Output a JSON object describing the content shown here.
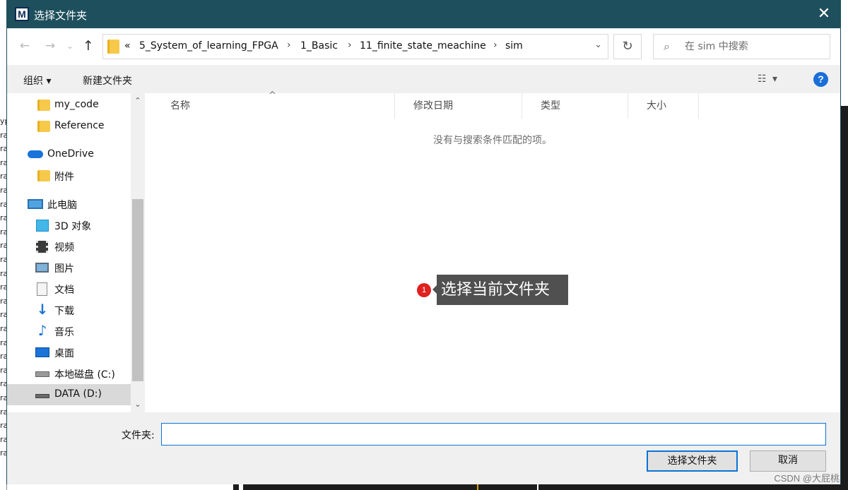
{
  "window": {
    "title": "选择文件夹",
    "app_icon_letter": "M",
    "close_glyph": "✕"
  },
  "nav": {
    "back_glyph": "←",
    "forward_glyph": "→",
    "history_glyph": "⌄",
    "up_glyph": "↑",
    "overflow_glyph": "«",
    "breadcrumbs": [
      "5_System_of_learning_FPGA",
      "1_Basic",
      "11_finite_state_meachine",
      "sim"
    ],
    "separator": "›",
    "dropdown_glyph": "⌄",
    "refresh_glyph": "↻"
  },
  "search": {
    "icon": "search-icon",
    "placeholder": "在 sim 中搜索"
  },
  "toolbar": {
    "organize_label": "组织 ▾",
    "new_folder_label": "新建文件夹",
    "view_glyph": "☷ ▾",
    "help_glyph": "?"
  },
  "tree": [
    {
      "label": "my_code",
      "icon": "folder-icon"
    },
    {
      "label": "Reference",
      "icon": "folder-icon"
    },
    {
      "label": "OneDrive",
      "icon": "cloud-icon"
    },
    {
      "label": "附件",
      "icon": "folder-icon"
    },
    {
      "label": "此电脑",
      "icon": "computer-icon"
    },
    {
      "label": "3D 对象",
      "icon": "cube-icon"
    },
    {
      "label": "视频",
      "icon": "video-icon"
    },
    {
      "label": "图片",
      "icon": "picture-icon"
    },
    {
      "label": "文档",
      "icon": "document-icon"
    },
    {
      "label": "下载",
      "icon": "download-icon"
    },
    {
      "label": "音乐",
      "icon": "music-icon"
    },
    {
      "label": "桌面",
      "icon": "desktop-icon"
    },
    {
      "label": "本地磁盘 (C:)",
      "icon": "drive-icon"
    },
    {
      "label": "DATA (D:)",
      "icon": "drive-icon"
    }
  ],
  "scroll": {
    "up_glyph": "⌃",
    "down_glyph": "⌄"
  },
  "columns": {
    "name": "名称",
    "modified": "修改日期",
    "type": "类型",
    "size": "大小",
    "sort_caret": "^"
  },
  "empty_message": "没有与搜索条件匹配的项。",
  "annotation": {
    "badge": "1",
    "text": "选择当前文件夹"
  },
  "bottom": {
    "folder_label": "文件夹:",
    "folder_value": "",
    "select_button": "选择文件夹",
    "cancel_button": "取消"
  },
  "watermark": "CSDN @大屁桃",
  "background_chars": [
    "yp",
    "ra",
    "ra",
    "ra",
    "ra",
    "ra",
    "ra",
    "ra",
    "ra",
    "ra",
    "ra",
    "ra",
    "ra",
    "ra",
    "ra",
    "ra",
    "ra",
    "ra",
    "ra",
    "ra",
    "ra",
    "ra",
    "ra",
    "ra",
    "ra"
  ]
}
